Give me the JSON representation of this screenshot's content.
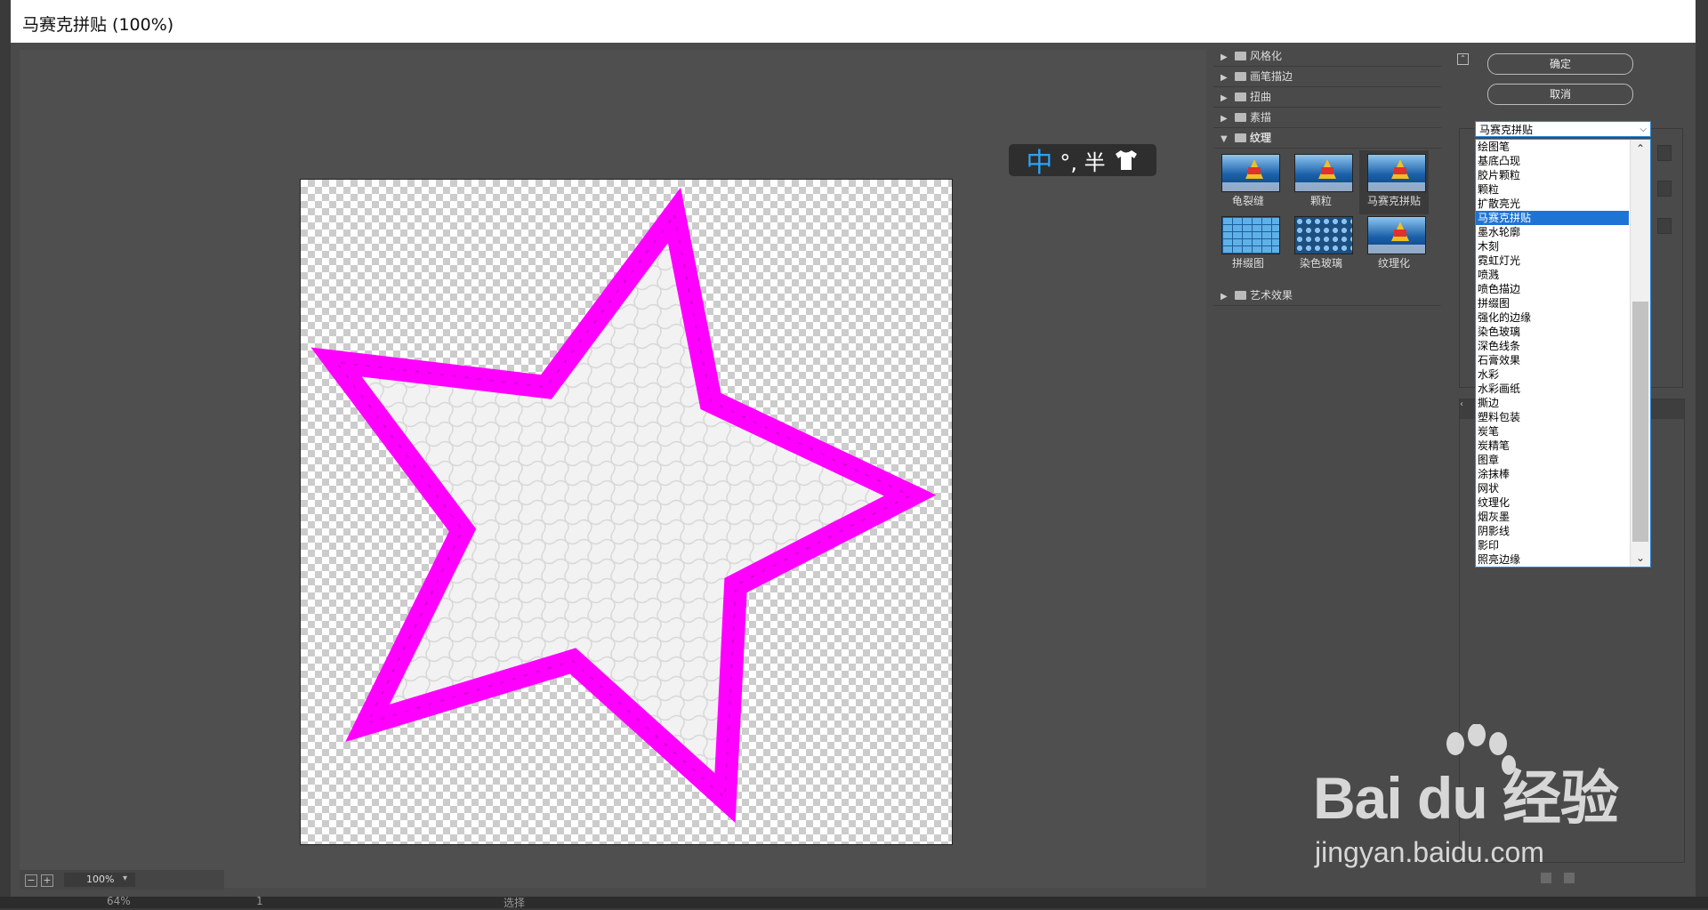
{
  "window": {
    "title": "马赛克拼贴 (100%)"
  },
  "ime": {
    "mode_char": "中",
    "symbols": "°, 半"
  },
  "zoom": {
    "value": "100%"
  },
  "bottom": {
    "zoom": "64%",
    "page": "1",
    "select": "选择"
  },
  "gallery": {
    "categories_top": [
      "风格化",
      "画笔描边",
      "扭曲",
      "素描"
    ],
    "open_category": "纹理",
    "thumbs": [
      "龟裂缝",
      "颗粒",
      "马赛克拼贴",
      "拼缀图",
      "染色玻璃",
      "纹理化"
    ],
    "selected_thumb": "马赛克拼贴",
    "categories_bottom": [
      "艺术效果"
    ]
  },
  "buttons": {
    "ok": "确定",
    "cancel": "取消"
  },
  "filter_dropdown": {
    "selected": "马赛克拼贴",
    "options": [
      "绘图笔",
      "基底凸现",
      "胶片颗粒",
      "颗粒",
      "扩散亮光",
      "马赛克拼贴",
      "墨水轮廓",
      "木刻",
      "霓虹灯光",
      "喷溅",
      "喷色描边",
      "拼缀图",
      "强化的边缘",
      "染色玻璃",
      "深色线条",
      "石膏效果",
      "水彩",
      "水彩画纸",
      "撕边",
      "塑料包装",
      "炭笔",
      "炭精笔",
      "图章",
      "涂抹棒",
      "网状",
      "纹理化",
      "烟灰墨",
      "阴影线",
      "影印",
      "照亮边缘"
    ]
  },
  "watermark": {
    "brand": "Bai du 经验",
    "url": "jingyan.baidu.com"
  },
  "colors": {
    "star_stroke": "#ff00ff",
    "accent": "#1e74d4"
  }
}
